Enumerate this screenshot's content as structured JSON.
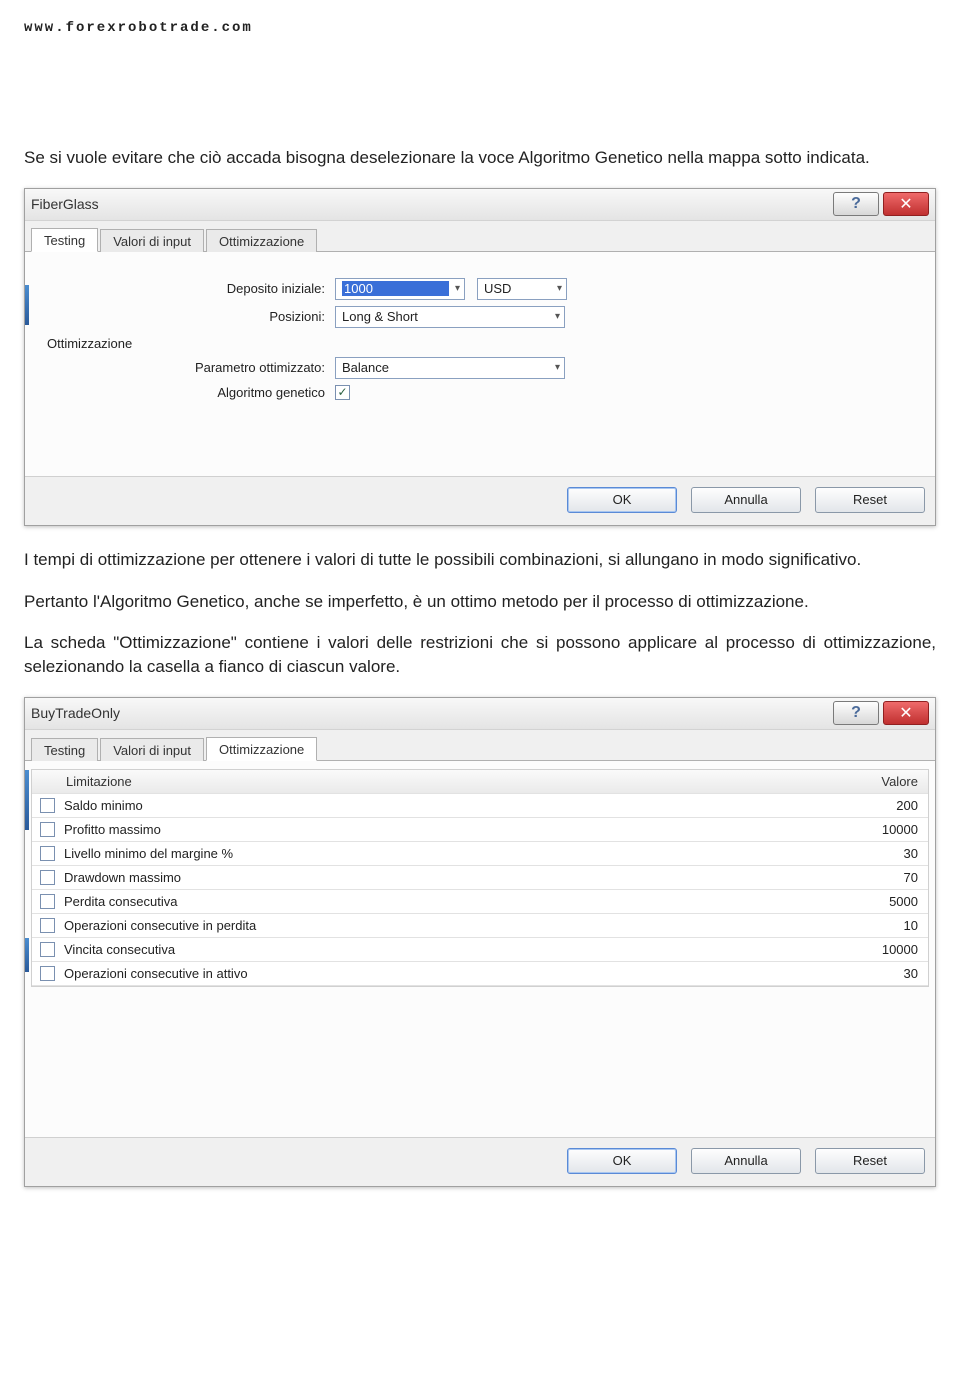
{
  "header_url": "www.forexrobotrade.com",
  "text": {
    "p1": "Se si vuole evitare che ciò accada bisogna deselezionare la voce Algoritmo Genetico nella mappa sotto indicata.",
    "p2": "I tempi di ottimizzazione per ottenere i valori di tutte le possibili combinazioni, si allungano in modo significativo.",
    "p3": "Pertanto l'Algoritmo Genetico, anche se imperfetto, è un ottimo metodo per il processo di ottimizzazione.",
    "p4": "La scheda \"Ottimizzazione\" contiene i valori delle restrizioni che si possono applicare al processo di ottimizzazione, selezionando la casella a fianco di ciascun valore."
  },
  "dialog1": {
    "title": "FiberGlass",
    "tabs": [
      "Testing",
      "Valori di input",
      "Ottimizzazione"
    ],
    "active_tab": 0,
    "labels": {
      "deposito": "Deposito iniziale:",
      "posizioni": "Posizioni:",
      "group": "Ottimizzazione",
      "parametro": "Parametro ottimizzato:",
      "algoritmo": "Algoritmo genetico"
    },
    "values": {
      "deposito": "1000",
      "currency": "USD",
      "posizioni": "Long & Short",
      "parametro": "Balance",
      "algoritmo_checked": "✓"
    },
    "buttons": {
      "ok": "OK",
      "cancel": "Annulla",
      "reset": "Reset"
    }
  },
  "dialog2": {
    "title": "BuyTradeOnly",
    "tabs": [
      "Testing",
      "Valori di input",
      "Ottimizzazione"
    ],
    "active_tab": 2,
    "columns": {
      "name": "Limitazione",
      "value": "Valore"
    },
    "rows": [
      {
        "name": "Saldo minimo",
        "value": "200"
      },
      {
        "name": "Profitto massimo",
        "value": "10000"
      },
      {
        "name": "Livello minimo del margine %",
        "value": "30"
      },
      {
        "name": "Drawdown massimo",
        "value": "70"
      },
      {
        "name": "Perdita consecutiva",
        "value": "5000"
      },
      {
        "name": "Operazioni consecutive in perdita",
        "value": "10"
      },
      {
        "name": "Vincita consecutiva",
        "value": "10000"
      },
      {
        "name": "Operazioni consecutive in attivo",
        "value": "30"
      }
    ],
    "buttons": {
      "ok": "OK",
      "cancel": "Annulla",
      "reset": "Reset"
    }
  }
}
